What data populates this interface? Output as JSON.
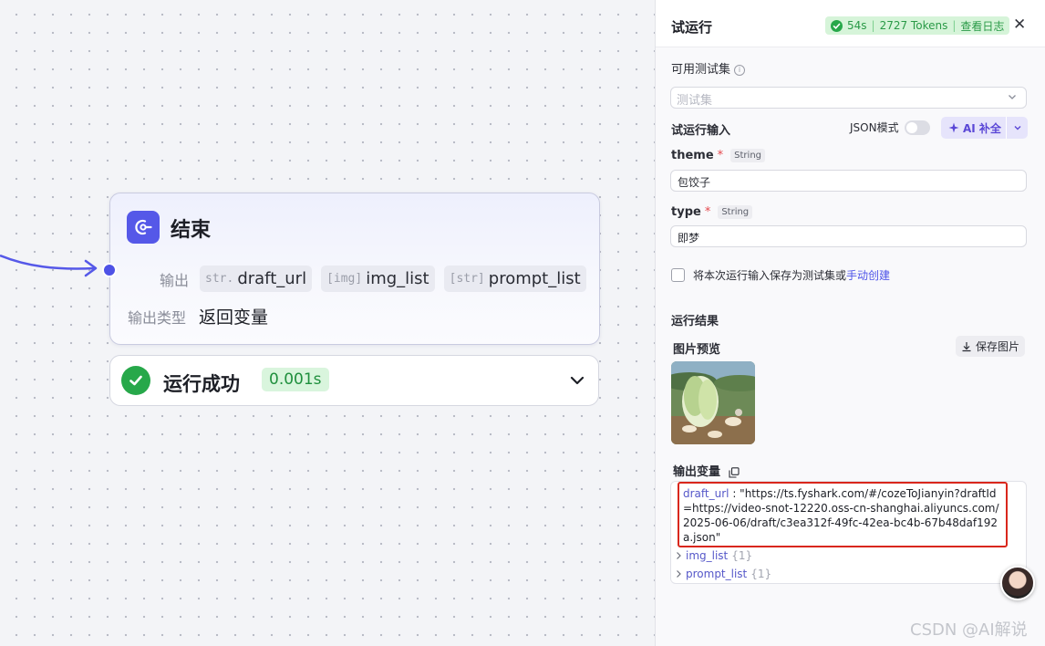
{
  "canvas": {
    "end_node": {
      "title": "结束",
      "output_label": "输出",
      "outputs": [
        {
          "prefix": "str.",
          "name": "draft_url"
        },
        {
          "prefix": "[img]",
          "name": "img_list"
        },
        {
          "prefix": "[str]",
          "name": "prompt_list"
        }
      ],
      "output_type_label": "输出类型",
      "output_type_value": "返回变量"
    },
    "run_status": {
      "text": "运行成功",
      "time": "0.001s"
    }
  },
  "panel": {
    "title": "试运行",
    "stats": {
      "duration": "54s",
      "tokens": "2727 Tokens",
      "log_link": "查看日志"
    },
    "close_label": "✕",
    "testset": {
      "label": "可用测试集",
      "placeholder": "测试集"
    },
    "run_input_label": "试运行输入",
    "json_mode_label": "JSON模式",
    "ai_fill_label": "AI 补全",
    "fields": [
      {
        "name": "theme",
        "type": "String",
        "value": "包饺子"
      },
      {
        "name": "type",
        "type": "String",
        "value": "即梦"
      }
    ],
    "save_testset": {
      "text": "将本次运行输入保存为测试集或",
      "link": "手动创建"
    },
    "result_label": "运行结果",
    "image_preview_label": "图片预览",
    "save_image_label": "保存图片",
    "output_vars_label": "输出变量",
    "output": {
      "draft_url_key": "draft_url",
      "draft_url_value": "\"https://ts.fyshark.com/#/cozeToJianyin?draftId=https://video-snot-12220.oss-cn-shanghai.aliyuncs.com/2025-06-06/draft/c3ea312f-49fc-42ea-bc4b-67b48daf192a.json\"",
      "img_list_key": "img_list",
      "img_list_count": "{1}",
      "prompt_list_key": "prompt_list",
      "prompt_list_count": "{1}"
    }
  },
  "watermark": "CSDN @AI解说",
  "colors": {
    "accent": "#4e52e6",
    "success": "#27a84a",
    "highlight_border": "#d9271c"
  }
}
